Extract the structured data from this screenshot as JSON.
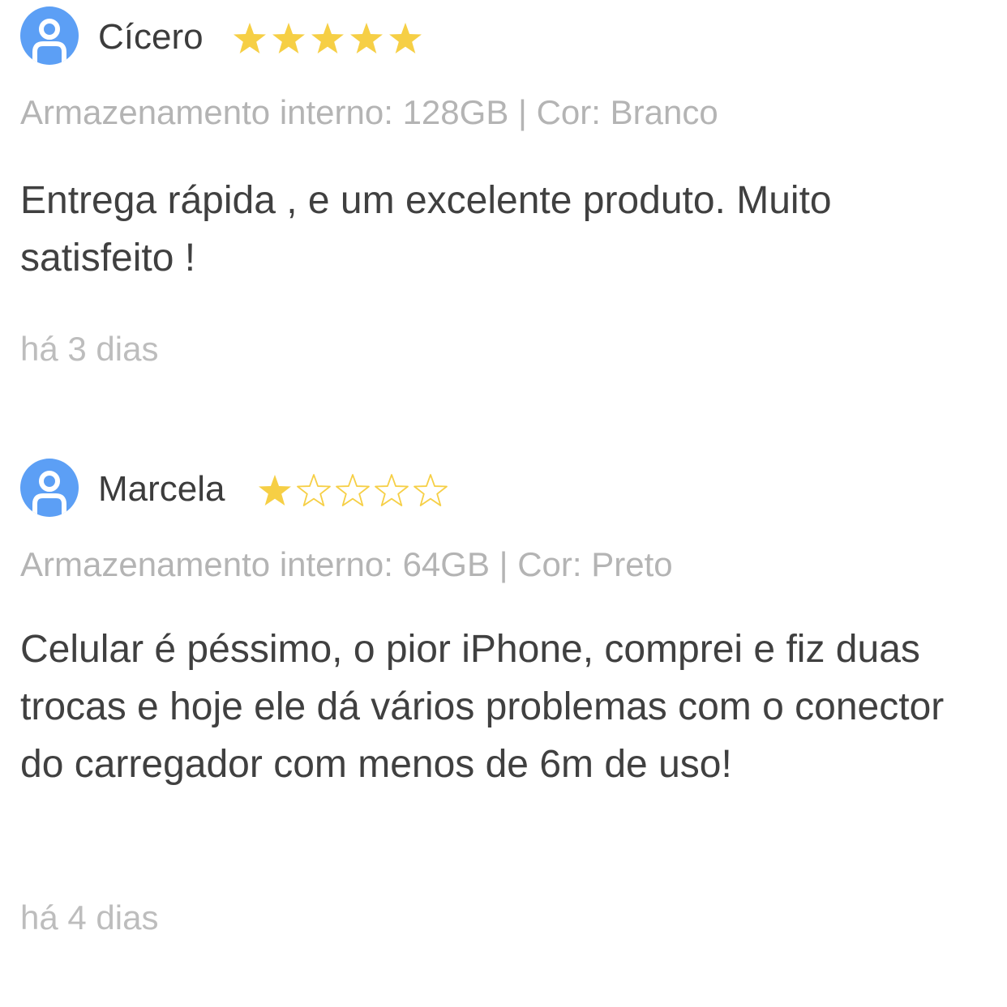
{
  "reviews": [
    {
      "reviewer": "Cícero",
      "rating": 5,
      "max_rating": 5,
      "variant": "Armazenamento interno: 128GB | Cor: Branco",
      "text": "Entrega rápida , e um excelente produto. Muito satisfeito !",
      "time_ago": "há 3 dias"
    },
    {
      "reviewer": "Marcela",
      "rating": 1,
      "max_rating": 5,
      "variant": "Armazenamento interno: 64GB | Cor: Preto",
      "text": "Celular é péssimo, o pior iPhone, comprei e fiz duas trocas e hoje ele dá vários problemas com o conector do carregador com menos de 6m de uso!",
      "time_ago": "há 4 dias"
    }
  ],
  "icons": {
    "avatar": "user-icon",
    "star_filled": "star-filled-icon",
    "star_empty": "star-outline-icon"
  },
  "colors": {
    "avatar_bg": "#5c9ff5",
    "star": "#f6cf45",
    "name_text": "#3c3c3c",
    "muted_text": "#b4b4b4",
    "body_text": "#404040"
  }
}
